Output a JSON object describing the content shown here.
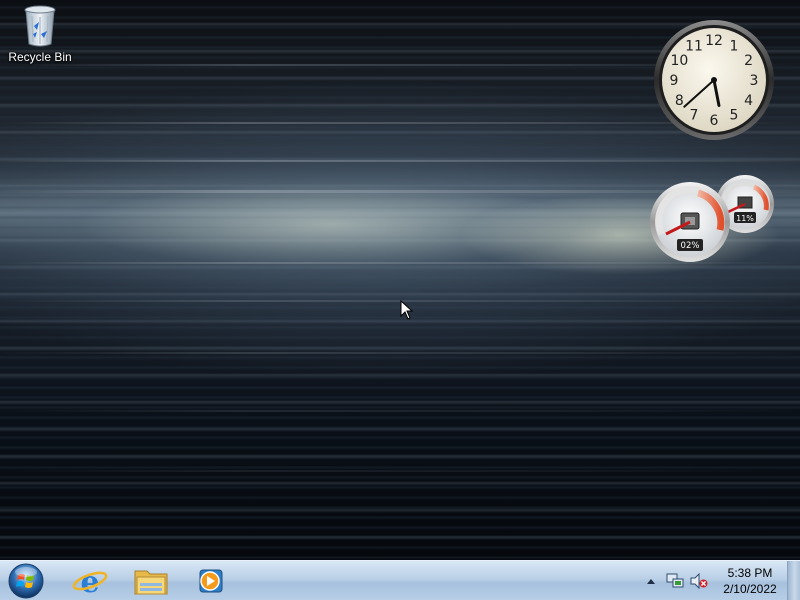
{
  "desktop": {
    "icons": [
      {
        "label": "Recycle Bin",
        "icon": "recycle-bin-icon"
      }
    ]
  },
  "gadgets": {
    "clock": {
      "numerals": [
        "12",
        "1",
        "2",
        "3",
        "4",
        "5",
        "6",
        "7",
        "8",
        "9",
        "10",
        "11"
      ],
      "time_hour": 5,
      "time_minute": 38
    },
    "cpu_meter": {
      "cpu_label": "02%",
      "memory_label": "11%",
      "cpu_value": 2,
      "memory_value": 11
    }
  },
  "taskbar": {
    "start_icon": "windows-orb-icon",
    "pinned": [
      {
        "name": "Internet Explorer",
        "icon": "internet-explorer-icon"
      },
      {
        "name": "Windows Explorer",
        "icon": "folder-icon"
      },
      {
        "name": "Windows Media Player",
        "icon": "media-player-icon"
      }
    ],
    "tray": {
      "time": "5:38 PM",
      "date": "2/10/2022",
      "icons": [
        "show-hidden-icons-arrow",
        "network-icon",
        "volume-muted-icon"
      ]
    },
    "colors": {
      "taskbar": "#b9cfe6"
    }
  }
}
